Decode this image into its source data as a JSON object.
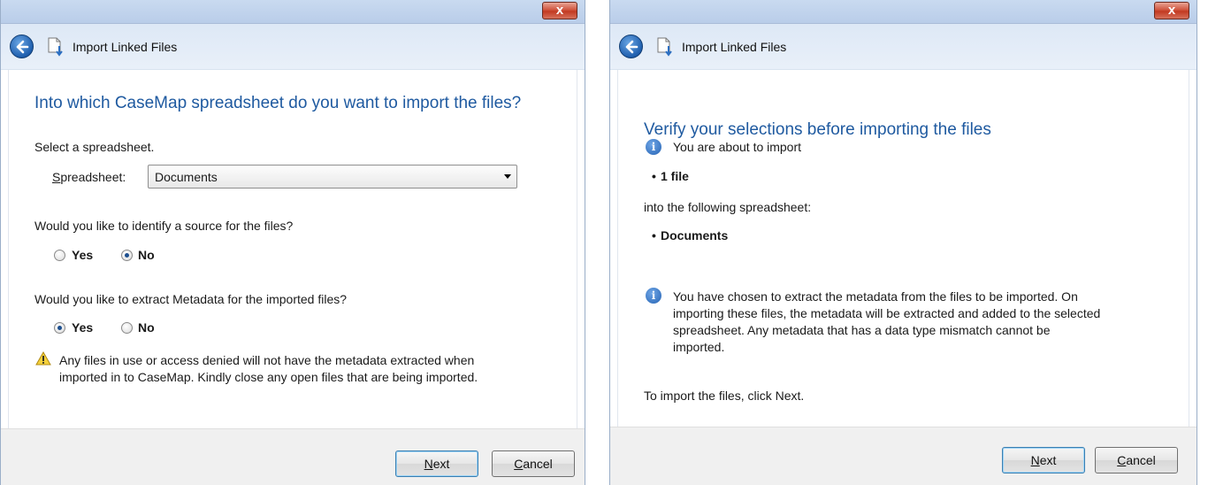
{
  "dialog1": {
    "close_label": "x",
    "nav_title": "Import Linked Files",
    "heading": "Into which CaseMap spreadsheet do you want to import the files?",
    "select_prompt": "Select a spreadsheet.",
    "spreadsheet_label_s": "S",
    "spreadsheet_label_rest": "preadsheet:",
    "spreadsheet_value": "Documents",
    "source_question": "Would you like to identify a source for the files?",
    "source_yes": "Yes",
    "source_no": "No",
    "source_selected": "No",
    "metadata_question": "Would you like to extract Metadata for the imported files?",
    "metadata_yes": "Yes",
    "metadata_no": "No",
    "metadata_selected": "Yes",
    "warning_line1": "Any files in use or access denied will not have the metadata extracted when",
    "warning_line2": "imported in to CaseMap. Kindly close any open files that are being imported.",
    "next_underline": "N",
    "next_rest": "ext",
    "cancel_underline": "C",
    "cancel_rest": "ancel"
  },
  "dialog2": {
    "close_label": "x",
    "nav_title": "Import Linked Files",
    "heading": "Verify your selections before importing the files",
    "about_to_import": "You are about to import",
    "bullet_char": "•",
    "file_count": "1 file",
    "into_spreadsheet": "into the following spreadsheet:",
    "spreadsheet_name": "Documents",
    "metadata_line1": "You have chosen to extract the metadata from the files to be imported. On",
    "metadata_line2": "importing these files, the metadata will be extracted and added to the selected",
    "metadata_line3": "spreadsheet. Any metadata that has a data type mismatch cannot be",
    "metadata_line4": "imported.",
    "instruction": "To import the files, click Next.",
    "next_underline": "N",
    "next_rest": "ext",
    "cancel_underline": "C",
    "cancel_rest": "ancel"
  },
  "colors": {
    "heading_blue": "#1f5aa0",
    "titlebar": "#c9daf0",
    "close_red": "#c23a22",
    "footer_bg": "#f0f0f0"
  },
  "icons": {
    "back": "back-arrow-icon",
    "doc": "import-document-icon",
    "warning": "warning-icon",
    "info": "info-icon",
    "dropdown": "chevron-down-icon"
  }
}
